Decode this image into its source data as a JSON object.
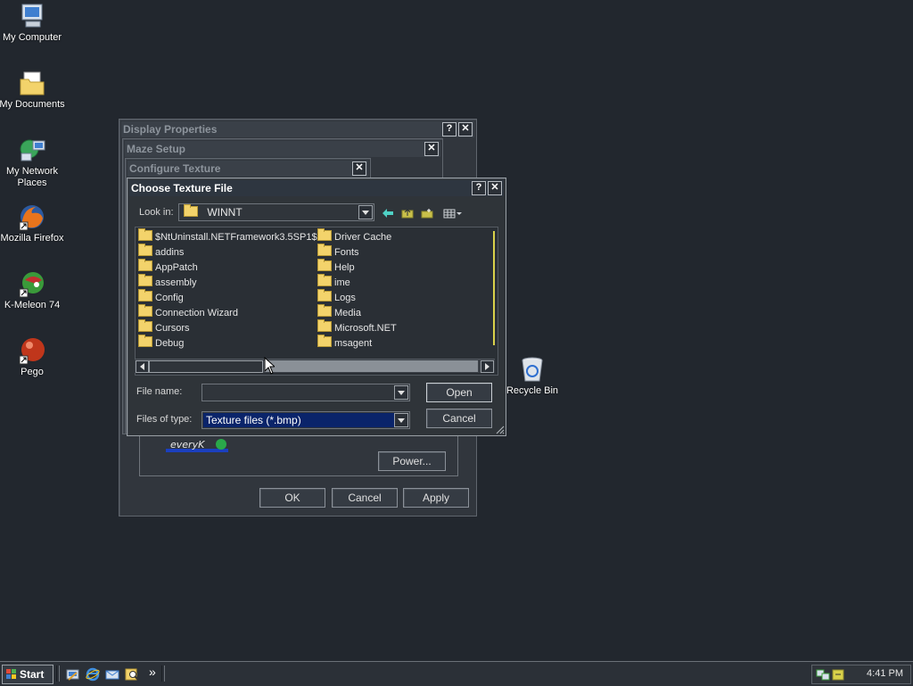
{
  "desktop": {
    "icons": [
      {
        "label": "My Computer",
        "icon": "my-computer-icon"
      },
      {
        "label": "My Documents",
        "icon": "my-documents-icon"
      },
      {
        "label": "My Network Places",
        "icon": "network-places-icon"
      },
      {
        "label": "Mozilla Firefox",
        "icon": "firefox-icon"
      },
      {
        "label": "K-Meleon 74",
        "icon": "k-meleon-icon"
      },
      {
        "label": "Pego",
        "icon": "pego-icon"
      },
      {
        "label": "Recycle Bin",
        "icon": "recycle-bin-icon"
      }
    ]
  },
  "display_properties": {
    "title": "Display Properties",
    "buttons": {
      "ok": "OK",
      "cancel": "Cancel",
      "apply": "Apply",
      "power": "Power..."
    }
  },
  "maze_setup": {
    "title": "Maze Setup"
  },
  "configure_texture": {
    "title": "Configure Texture"
  },
  "choose_texture": {
    "title": "Choose Texture File",
    "look_in_label": "Look in:",
    "look_in_value": "WINNT",
    "file_name_label": "File name:",
    "file_name_value": "",
    "files_of_type_label": "Files of type:",
    "files_of_type_value": "Texture files (*.bmp)",
    "open_label": "Open",
    "cancel_label": "Cancel",
    "folders_col1": [
      "$NtUninstall.NETFramework3.5SP1$",
      "addins",
      "AppPatch",
      "assembly",
      "Config",
      "Connection Wizard",
      "Cursors",
      "Debug"
    ],
    "folders_col2": [
      "Driver Cache",
      "Fonts",
      "Help",
      "ime",
      "Logs",
      "Media",
      "Microsoft.NET",
      "msagent"
    ]
  },
  "taskbar": {
    "start_label": "Start",
    "clock": "4:41 PM",
    "chevron": "»"
  },
  "colors": {
    "desktop": "#22272e",
    "selection": "#0a246a",
    "folder": "#f3d36b"
  }
}
